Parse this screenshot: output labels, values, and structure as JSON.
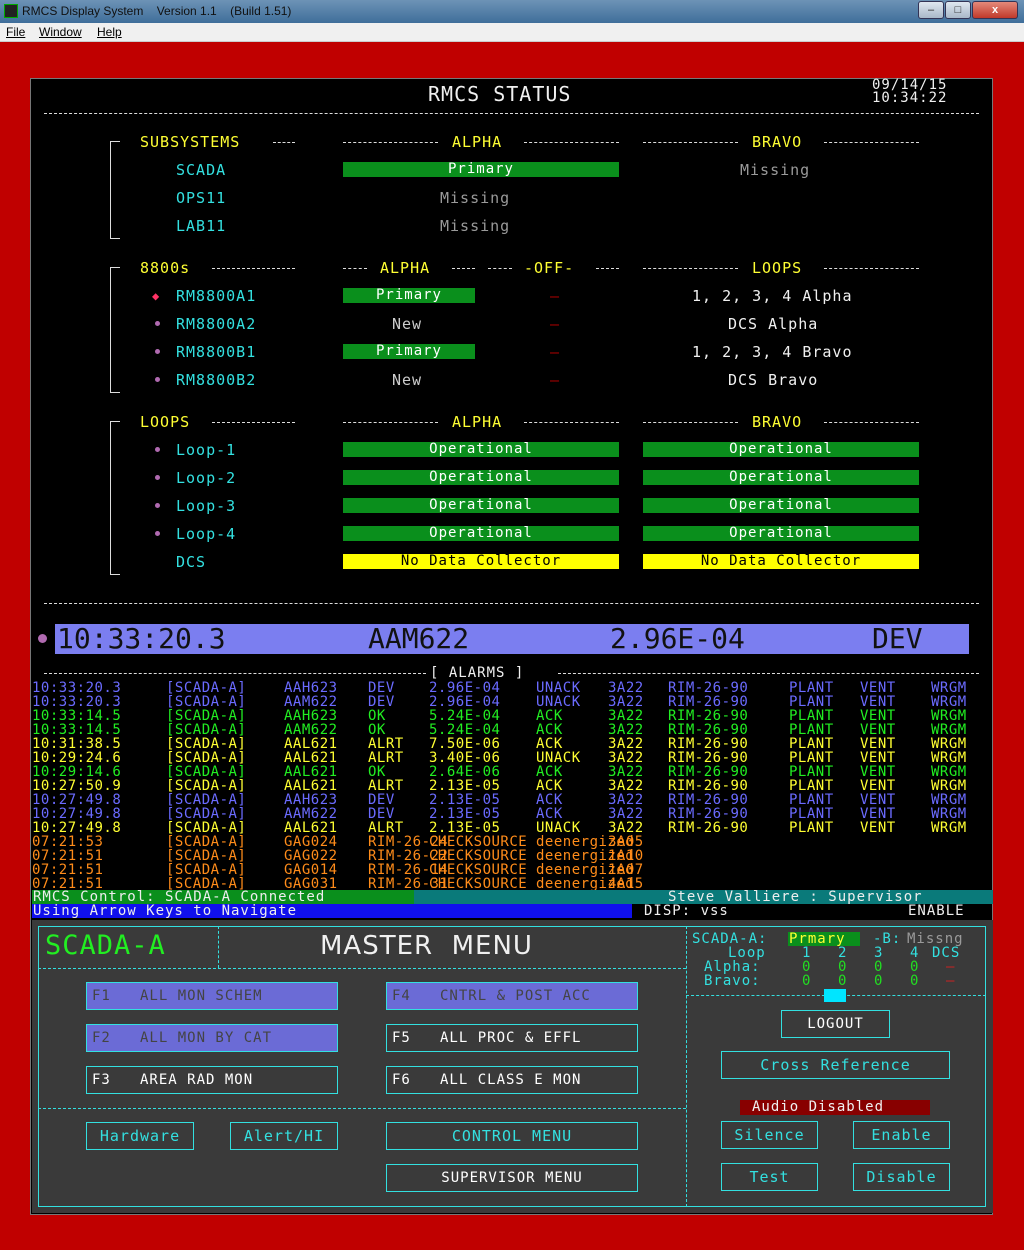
{
  "window": {
    "title": "RMCS Display System    Version 1.1    (Build 1.51)",
    "menu": [
      "File",
      "Window",
      "Help"
    ],
    "controls": {
      "minimize": "–",
      "maximize": "□",
      "close": "x"
    }
  },
  "header": {
    "title": "RMCS STATUS",
    "date": "09/14/15",
    "time": "10:34:22"
  },
  "subsystems": {
    "heading": "SUBSYSTEMS",
    "col_alpha": "ALPHA",
    "col_bravo": "BRAVO",
    "rows": [
      {
        "name": "SCADA",
        "alpha": "Primary",
        "bravo": "Missing"
      },
      {
        "name": "OPS11",
        "alpha": "Missing"
      },
      {
        "name": "LAB11",
        "alpha": "Missing"
      }
    ]
  },
  "units": {
    "heading": "8800s",
    "col_alpha": "ALPHA",
    "col_off": "-OFF-",
    "col_loops": "LOOPS",
    "rows": [
      {
        "name": "RM8800A1",
        "alpha": "Primary",
        "off": "–",
        "loops": "1, 2, 3, 4 Alpha"
      },
      {
        "name": "RM8800A2",
        "alpha": "New",
        "off": "–",
        "loops": "DCS Alpha"
      },
      {
        "name": "RM8800B1",
        "alpha": "Primary",
        "off": "–",
        "loops": "1, 2, 3, 4 Bravo"
      },
      {
        "name": "RM8800B2",
        "alpha": "New",
        "off": "–",
        "loops": "DCS Bravo"
      }
    ]
  },
  "loops": {
    "heading": "LOOPS",
    "col_alpha": "ALPHA",
    "col_bravo": "BRAVO",
    "rows": [
      {
        "name": "Loop-1",
        "alpha": "Operational",
        "bravo": "Operational"
      },
      {
        "name": "Loop-2",
        "alpha": "Operational",
        "bravo": "Operational"
      },
      {
        "name": "Loop-3",
        "alpha": "Operational",
        "bravo": "Operational"
      },
      {
        "name": "Loop-4",
        "alpha": "Operational",
        "bravo": "Operational"
      },
      {
        "name": "DCS",
        "alpha": "No Data Collector",
        "bravo": "No Data Collector"
      }
    ]
  },
  "banner": {
    "time": "10:33:20.3",
    "id": "AAM622",
    "value": "2.96E-04",
    "state": "DEV"
  },
  "alarms": {
    "heading": "[ ALARMS ]",
    "rows": [
      {
        "c": "blue",
        "time": "10:33:20.3",
        "sys": "[SCADA-A]",
        "id": "AAH623",
        "st": "DEV",
        "val": "2.96E-04",
        "ack": "UNACK",
        "loc": "3A22",
        "rim": "RIM-26-90",
        "a": "PLANT",
        "b": "VENT",
        "c2": "WRGM"
      },
      {
        "c": "blue",
        "time": "10:33:20.3",
        "sys": "[SCADA-A]",
        "id": "AAM622",
        "st": "DEV",
        "val": "2.96E-04",
        "ack": "UNACK",
        "loc": "3A22",
        "rim": "RIM-26-90",
        "a": "PLANT",
        "b": "VENT",
        "c2": "WRGM"
      },
      {
        "c": "green",
        "time": "10:33:14.5",
        "sys": "[SCADA-A]",
        "id": "AAH623",
        "st": "OK",
        "val": "5.24E-04",
        "ack": "ACK",
        "loc": "3A22",
        "rim": "RIM-26-90",
        "a": "PLANT",
        "b": "VENT",
        "c2": "WRGM"
      },
      {
        "c": "green",
        "time": "10:33:14.5",
        "sys": "[SCADA-A]",
        "id": "AAM622",
        "st": "OK",
        "val": "5.24E-04",
        "ack": "ACK",
        "loc": "3A22",
        "rim": "RIM-26-90",
        "a": "PLANT",
        "b": "VENT",
        "c2": "WRGM"
      },
      {
        "c": "yellow",
        "time": "10:31:38.5",
        "sys": "[SCADA-A]",
        "id": "AAL621",
        "st": "ALRT",
        "val": "7.50E-06",
        "ack": "ACK",
        "loc": "3A22",
        "rim": "RIM-26-90",
        "a": "PLANT",
        "b": "VENT",
        "c2": "WRGM"
      },
      {
        "c": "yellow",
        "time": "10:29:24.6",
        "sys": "[SCADA-A]",
        "id": "AAL621",
        "st": "ALRT",
        "val": "3.40E-06",
        "ack": "UNACK",
        "loc": "3A22",
        "rim": "RIM-26-90",
        "a": "PLANT",
        "b": "VENT",
        "c2": "WRGM"
      },
      {
        "c": "green",
        "time": "10:29:14.6",
        "sys": "[SCADA-A]",
        "id": "AAL621",
        "st": "OK",
        "val": "2.64E-06",
        "ack": "ACK",
        "loc": "3A22",
        "rim": "RIM-26-90",
        "a": "PLANT",
        "b": "VENT",
        "c2": "WRGM"
      },
      {
        "c": "yellow",
        "time": "10:27:50.9",
        "sys": "[SCADA-A]",
        "id": "AAL621",
        "st": "ALRT",
        "val": "2.13E-05",
        "ack": "ACK",
        "loc": "3A22",
        "rim": "RIM-26-90",
        "a": "PLANT",
        "b": "VENT",
        "c2": "WRGM"
      },
      {
        "c": "blue",
        "time": "10:27:49.8",
        "sys": "[SCADA-A]",
        "id": "AAH623",
        "st": "DEV",
        "val": "2.13E-05",
        "ack": "ACK",
        "loc": "3A22",
        "rim": "RIM-26-90",
        "a": "PLANT",
        "b": "VENT",
        "c2": "WRGM"
      },
      {
        "c": "blue",
        "time": "10:27:49.8",
        "sys": "[SCADA-A]",
        "id": "AAM622",
        "st": "DEV",
        "val": "2.13E-05",
        "ack": "ACK",
        "loc": "3A22",
        "rim": "RIM-26-90",
        "a": "PLANT",
        "b": "VENT",
        "c2": "WRGM"
      },
      {
        "c": "yellow",
        "time": "10:27:49.8",
        "sys": "[SCADA-A]",
        "id": "AAL621",
        "st": "ALRT",
        "val": "2.13E-05",
        "ack": "UNACK",
        "loc": "3A22",
        "rim": "RIM-26-90",
        "a": "PLANT",
        "b": "VENT",
        "c2": "WRGM"
      },
      {
        "c": "orange",
        "time": "07:21:53",
        "sys": "[SCADA-A]",
        "id": "GAG024",
        "st": "RIM-26-24",
        "val": "CHECKSOURCE",
        "ack": "deenergized",
        "loc": "3A05",
        "rim": "",
        "a": "",
        "b": "",
        "c2": ""
      },
      {
        "c": "orange",
        "time": "07:21:51",
        "sys": "[SCADA-A]",
        "id": "GAG022",
        "st": "RIM-26-22",
        "val": "CHECKSOURCE",
        "ack": "deenergized",
        "loc": "1A10",
        "rim": "",
        "a": "",
        "b": "",
        "c2": ""
      },
      {
        "c": "orange",
        "time": "07:21:51",
        "sys": "[SCADA-A]",
        "id": "GAG014",
        "st": "RIM-26-14",
        "val": "CHECKSOURCE",
        "ack": "deenergized",
        "loc": "1A07",
        "rim": "",
        "a": "",
        "b": "",
        "c2": ""
      },
      {
        "c": "orange",
        "time": "07:21:51",
        "sys": "[SCADA-A]",
        "id": "GAG031",
        "st": "RIM-26-31",
        "val": "CHECKSOURCE",
        "ack": "deenergized",
        "loc": "4A15",
        "rim": "",
        "a": "",
        "b": "",
        "c2": ""
      }
    ]
  },
  "statusbar": {
    "control": "RMCS Control: SCADA-A Connected",
    "user": "Steve Valliere : Supervisor",
    "hint": "Using Arrow Keys to Navigate",
    "disp": "DISP: vss",
    "enable": "ENABLE"
  },
  "master_menu": {
    "node": "SCADA-A",
    "title": "MASTER  MENU",
    "buttons": [
      {
        "key": "F1",
        "label": "ALL MON SCHEM"
      },
      {
        "key": "F2",
        "label": "ALL MON BY CAT"
      },
      {
        "key": "F3",
        "label": "AREA RAD MON"
      },
      {
        "key": "F4",
        "label": "CNTRL & POST ACC"
      },
      {
        "key": "F5",
        "label": "ALL PROC & EFFL"
      },
      {
        "key": "F6",
        "label": "ALL CLASS E MON"
      }
    ],
    "hardware": "Hardware",
    "alert_hi": "Alert/HI",
    "control_menu": "CONTROL MENU",
    "supervisor_menu": "SUPERVISOR  MENU"
  },
  "side_panel": {
    "scada_a_label": "SCADA-A:",
    "scada_a_value": "Prmary",
    "scada_b_label": "-B:",
    "scada_b_value": "Missng",
    "loop_label": "Loop",
    "loop_cols": [
      "1",
      "2",
      "3",
      "4",
      "DCS"
    ],
    "alpha_label": "Alpha:",
    "alpha_vals": [
      "0",
      "0",
      "0",
      "0",
      "–"
    ],
    "bravo_label": "Bravo:",
    "bravo_vals": [
      "0",
      "0",
      "0",
      "0",
      "–"
    ],
    "logout": "LOGOUT",
    "cross_reference": "Cross  Reference",
    "audio_status": "Audio Disabled",
    "silence": "Silence",
    "enable": "Enable",
    "test": "Test",
    "disable": "Disable"
  },
  "colors": {
    "frame": "#c00000",
    "ok_bar": "#0a8f1c",
    "warn_bar": "#ffff00",
    "banner": "#7b7ef0",
    "cyan": "#33e0e0",
    "yellow": "#ffff33"
  }
}
